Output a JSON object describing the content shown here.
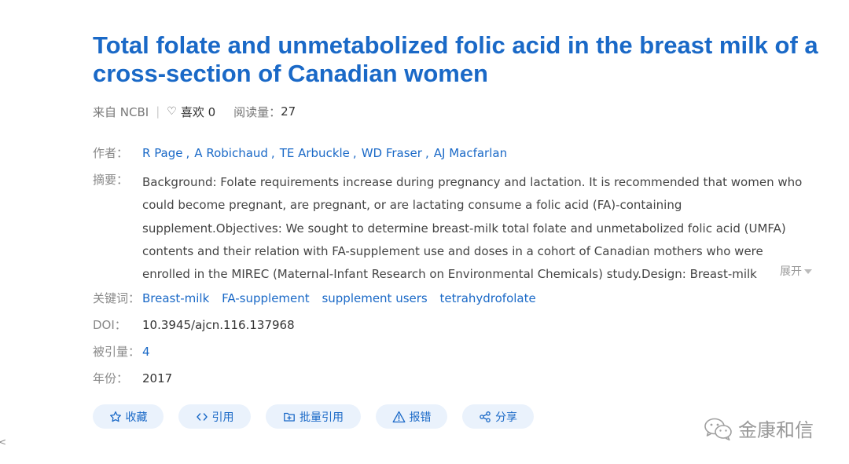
{
  "article": {
    "title": "Total folate and unmetabolized folic acid in the breast milk of a cross-section of Canadian women",
    "source": "来自 NCBI",
    "likes_label": "喜欢 0",
    "views_label": "阅读量：",
    "views_value": "27"
  },
  "labels": {
    "authors": "作者：",
    "abstract": "摘要：",
    "keywords": "关键词：",
    "doi": "DOI：",
    "cited": "被引量：",
    "year": "年份："
  },
  "authors": [
    "R Page",
    "A Robichaud",
    "TE Arbuckle",
    "WD Fraser",
    "AJ Macfarlan"
  ],
  "abstract_text": "Background: Folate requirements increase during pregnancy and lactation. It is recommended that women who could become pregnant, are pregnant, or are lactating consume a folic acid (FA)-containing supplement.Objectives: We sought to determine breast-milk total folate and unmetabolized folic acid (UMFA) contents and their relation with FA-supplement use and doses in a cohort of Canadian mothers who were enrolled in the MIREC (Maternal-Infant Research on Environmental Chemicals) study.Design: Breast-milk",
  "expand_label": "展开",
  "keywords": [
    "Breast-milk",
    "FA-supplement",
    "supplement users",
    "tetrahydrofolate"
  ],
  "doi": "10.3945/ajcn.116.137968",
  "cited_count": "4",
  "year": "2017",
  "actions": [
    {
      "id": "favorite",
      "label": "收藏",
      "icon": "star-icon"
    },
    {
      "id": "cite",
      "label": "引用",
      "icon": "code-icon"
    },
    {
      "id": "batch-cite",
      "label": "批量引用",
      "icon": "folder-plus-icon"
    },
    {
      "id": "report",
      "label": "报错",
      "icon": "warning-icon"
    },
    {
      "id": "share",
      "label": "分享",
      "icon": "share-icon"
    }
  ],
  "watermark": "金康和信",
  "colors": {
    "accent": "#1a69c7",
    "button_bg": "#eaf2fc",
    "label": "#888888"
  }
}
